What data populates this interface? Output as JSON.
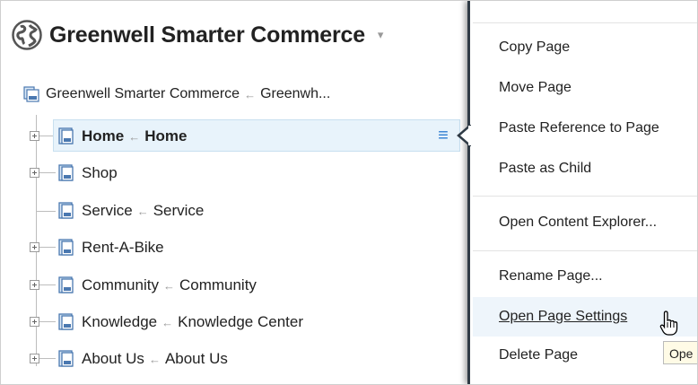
{
  "header": {
    "site_title": "Greenwell Smarter Commerce",
    "globe_icon": "globe-icon",
    "caret": "▾"
  },
  "root": {
    "label": "Greenwell Smarter Commerce",
    "arrow": "←",
    "target": "Greenwh..."
  },
  "tree": {
    "arrow": "←",
    "nodes": [
      {
        "label": "Home",
        "target": "Home",
        "expandable": true,
        "selected": true
      },
      {
        "label": "Shop",
        "target": "",
        "expandable": true,
        "selected": false
      },
      {
        "label": "Service",
        "target": "Service",
        "expandable": false,
        "selected": false
      },
      {
        "label": "Rent-A-Bike",
        "target": "",
        "expandable": true,
        "selected": false
      },
      {
        "label": "Community",
        "target": "Community",
        "expandable": true,
        "selected": false
      },
      {
        "label": "Knowledge",
        "target": "Knowledge Center",
        "expandable": true,
        "selected": false
      },
      {
        "label": "About Us",
        "target": "About Us",
        "expandable": true,
        "selected": false
      }
    ]
  },
  "menu_trigger": "≡",
  "context_menu": {
    "items": [
      "Copy Page",
      "Move Page",
      "Paste Reference to Page",
      "Paste as Child",
      "Open Content Explorer...",
      "Rename Page...",
      "Open Page Settings",
      "Delete Page"
    ],
    "highlighted": "Open Page Settings"
  },
  "tooltip": "Ope",
  "colors": {
    "selection_bg": "#e8f3fb",
    "menu_border": "#2f3a45",
    "accent": "#2f7dd0"
  }
}
